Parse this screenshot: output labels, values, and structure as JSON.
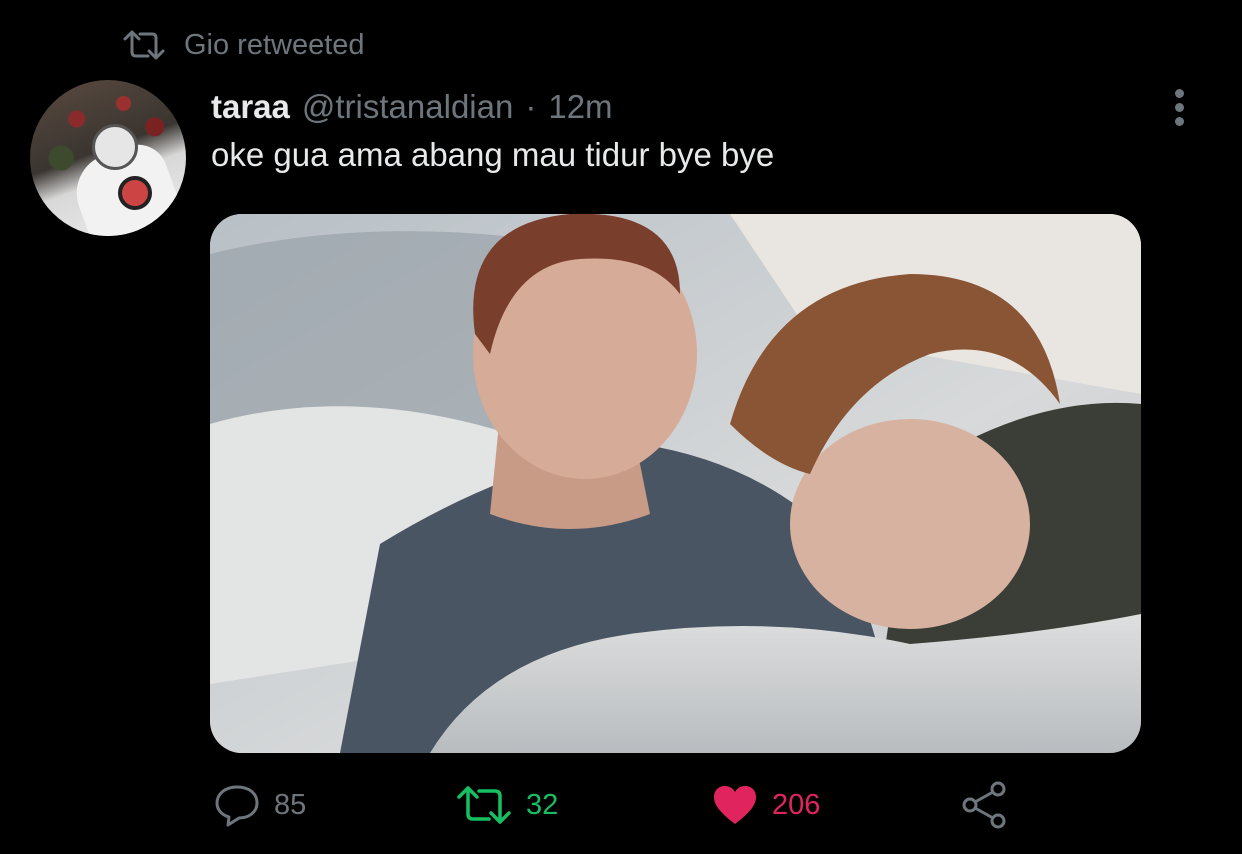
{
  "retweet_context": {
    "icon": "retweet-icon",
    "label": "Gio retweeted"
  },
  "tweet": {
    "avatar": "avatar-image",
    "display_name": "taraa",
    "handle": "@tristanaldian",
    "separator": "·",
    "timestamp": "12m",
    "text": "oke gua ama abang mau tidur bye bye",
    "media": "photo of two people lying on a bed"
  },
  "actions": {
    "reply": {
      "icon": "reply-icon",
      "count": "85"
    },
    "retweet": {
      "icon": "retweet-icon",
      "count": "32"
    },
    "like": {
      "icon": "heart-icon",
      "count": "206"
    },
    "share": {
      "icon": "share-icon"
    }
  },
  "colors": {
    "background": "#000000",
    "text_primary": "#e7e9ea",
    "text_secondary": "#6e767d",
    "retweet_active": "#17bf63",
    "like_active": "#e0245e"
  }
}
